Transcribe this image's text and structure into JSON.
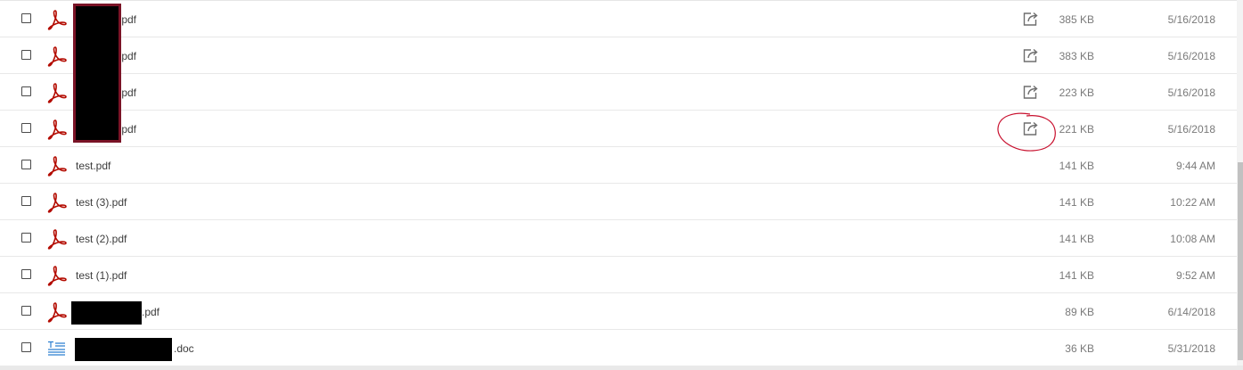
{
  "files": [
    {
      "name_visible": ".pdf",
      "type": "pdf",
      "size": "385 KB",
      "date": "5/16/2018",
      "share": true
    },
    {
      "name_visible": ".pdf",
      "type": "pdf",
      "size": "383 KB",
      "date": "5/16/2018",
      "share": true
    },
    {
      "name_visible": ".pdf",
      "type": "pdf",
      "size": "223 KB",
      "date": "5/16/2018",
      "share": true
    },
    {
      "name_visible": ".pdf",
      "type": "pdf",
      "size": "221 KB",
      "date": "5/16/2018",
      "share": true
    },
    {
      "name_visible": "test.pdf",
      "type": "pdf",
      "size": "141 KB",
      "date": "9:44 AM",
      "share": false
    },
    {
      "name_visible": "test (3).pdf",
      "type": "pdf",
      "size": "141 KB",
      "date": "10:22 AM",
      "share": false
    },
    {
      "name_visible": "test (2).pdf",
      "type": "pdf",
      "size": "141 KB",
      "date": "10:08 AM",
      "share": false
    },
    {
      "name_visible": "test (1).pdf",
      "type": "pdf",
      "size": "141 KB",
      "date": "9:52 AM",
      "share": false
    },
    {
      "name_visible": ".pdf",
      "type": "pdf",
      "size": "89 KB",
      "date": "6/14/2018",
      "share": false
    },
    {
      "name_visible": ".doc",
      "type": "doc",
      "size": "36 KB",
      "date": "5/31/2018",
      "share": false
    }
  ],
  "icons": {
    "pdf": "acrobat-pdf-icon",
    "doc": "text-document-icon",
    "share": "share-icon",
    "checkbox": "checkbox-icon"
  },
  "colors": {
    "pdf_icon": "#b30b00",
    "doc_icon": "#2c7fd1",
    "annotation": "#c8102e",
    "redaction_frame": "#7a1326"
  }
}
